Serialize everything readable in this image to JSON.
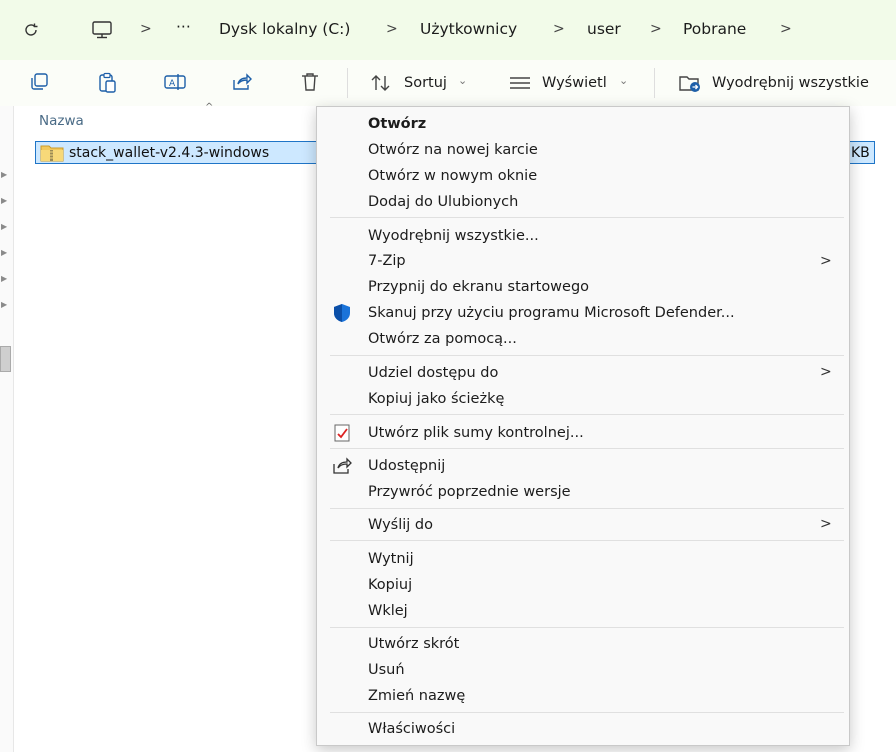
{
  "breadcrumb": {
    "more": "···",
    "items": [
      "Dysk lokalny (C:)",
      "Użytkownicy",
      "user",
      "Pobrane"
    ]
  },
  "toolbar": {
    "sort_label": "Sortuj",
    "view_label": "Wyświetl",
    "extract_label": "Wyodrębnij wszystkie"
  },
  "file_list": {
    "column_name": "Nazwa",
    "file_name": "stack_wallet-v2.4.3-windows",
    "file_size_fragment": "KB"
  },
  "context_menu": {
    "open": "Otwórz",
    "open_new_tab": "Otwórz na nowej karcie",
    "open_new_window": "Otwórz w nowym oknie",
    "add_favorites": "Dodaj do Ulubionych",
    "extract_all": "Wyodrębnij wszystkie...",
    "seven_zip": "7-Zip",
    "pin_start": "Przypnij do ekranu startowego",
    "scan_defender": "Skanuj przy użyciu programu Microsoft Defender...",
    "open_with": "Otwórz za pomocą...",
    "give_access": "Udziel dostępu do",
    "copy_path": "Kopiuj jako ścieżkę",
    "create_checksum": "Utwórz plik sumy kontrolnej...",
    "share": "Udostępnij",
    "restore_versions": "Przywróć poprzednie wersje",
    "send_to": "Wyślij do",
    "cut": "Wytnij",
    "copy": "Kopiuj",
    "paste": "Wklej",
    "create_shortcut": "Utwórz skrót",
    "delete": "Usuń",
    "rename": "Zmień nazwę",
    "properties": "Właściwości"
  },
  "colors": {
    "selection": "#cde8ff",
    "selection_border": "#1f75c7",
    "accent": "#0067c0"
  }
}
